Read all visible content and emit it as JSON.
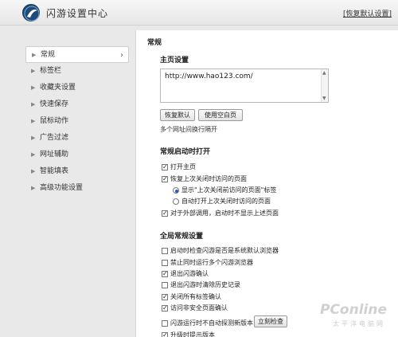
{
  "header": {
    "title": "闪游设置中心",
    "restore_label": "[恢复默认设置]"
  },
  "sidebar": {
    "items": [
      {
        "label": "常规"
      },
      {
        "label": "标签栏"
      },
      {
        "label": "收藏夹设置"
      },
      {
        "label": "快速保存"
      },
      {
        "label": "鼠标动作"
      },
      {
        "label": "广告过滤"
      },
      {
        "label": "网址辅助"
      },
      {
        "label": "智能填表"
      },
      {
        "label": "高级功能设置"
      }
    ]
  },
  "main": {
    "page_title": "常规",
    "homepage": {
      "title": "主页设置",
      "url_value": "http://www.hao123.com/",
      "restore_button": "恢复默认",
      "blank_button": "使用空白页",
      "hint": "多个网址间换行隔开"
    },
    "startup": {
      "title": "常规启动时打开",
      "open_home": "打开主页",
      "restore_last": "恢复上次关闭时访问的页面",
      "radio_show_tab": "显示\"上次关闭前访问的页面\"标签",
      "radio_auto_open": "自动打开上次关闭时访问的页面",
      "external_no_restore": "对于外部调用，启动时不显示上述页面"
    },
    "global": {
      "title": "全局常规设置",
      "check_default": "启动时检查闪游是否是系统默认浏览器",
      "no_multi": "禁止同时运行多个闪游浏览器",
      "confirm_exit": "退出闪游确认",
      "clear_history": "退出闪游时清除历史记录",
      "confirm_close_tabs": "关闭所有标签确认",
      "confirm_unsafe": "访问非安全页面确认",
      "no_update_check": "闪游运行时不自动探测新版本",
      "check_now_button": "立刻检查",
      "upgrade_prompt": "升级时提示版本"
    }
  },
  "watermark": {
    "text": "PConline",
    "sub": "太平洋电脑网"
  },
  "colors": {
    "logo": "#1f4a7a",
    "radio_dot": "#1f5fb0"
  }
}
